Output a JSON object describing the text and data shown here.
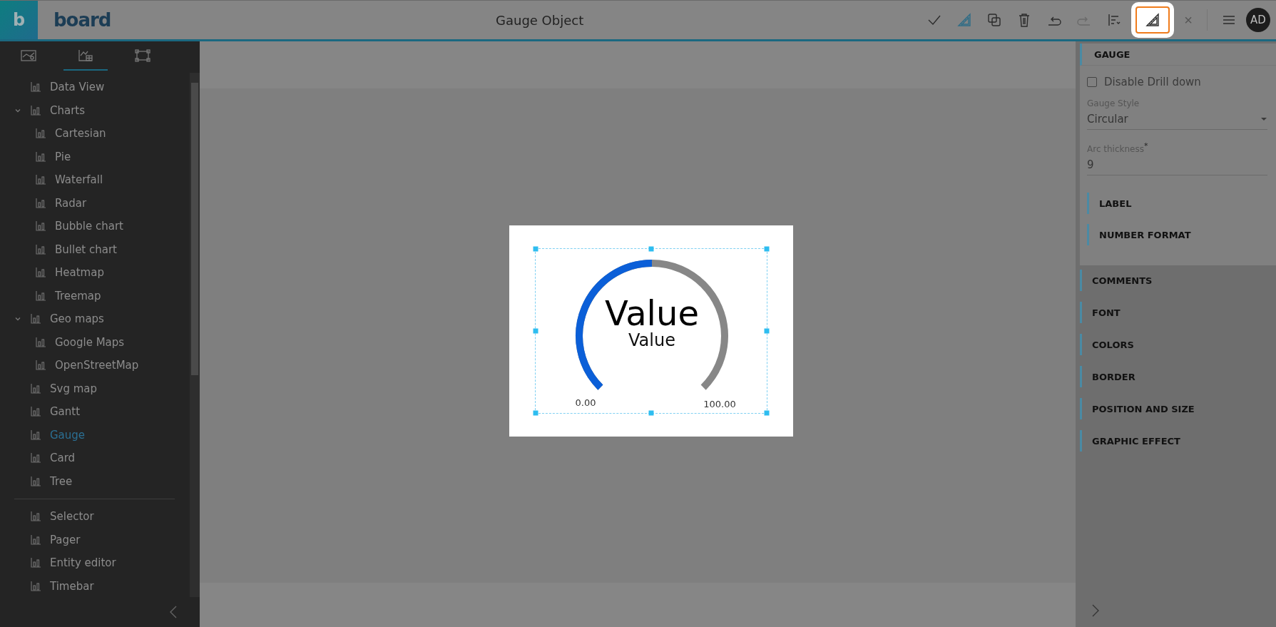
{
  "header": {
    "logo_letter": "b",
    "logo_text": "board",
    "title": "Gauge Object",
    "toolbar": [
      {
        "kind": "check",
        "active": false,
        "disabled": false,
        "highlighted": false
      },
      {
        "kind": "ruler",
        "active": true,
        "disabled": false,
        "highlighted": false
      },
      {
        "kind": "copy",
        "active": false,
        "disabled": false,
        "highlighted": false
      },
      {
        "kind": "trash",
        "active": false,
        "disabled": false,
        "highlighted": false
      },
      {
        "kind": "undo",
        "active": false,
        "disabled": false,
        "highlighted": false
      },
      {
        "kind": "redo",
        "active": false,
        "disabled": true,
        "highlighted": false
      },
      {
        "kind": "align",
        "active": false,
        "disabled": false,
        "highlighted": false
      },
      {
        "kind": "ruler",
        "active": false,
        "disabled": false,
        "highlighted": true
      }
    ],
    "close": "×",
    "avatar": "AD"
  },
  "sidebar": {
    "tabs": [
      {
        "kind": "layout",
        "selected": false
      },
      {
        "kind": "chart",
        "selected": true
      },
      {
        "kind": "frame",
        "selected": false
      }
    ],
    "groups": [
      {
        "items": [
          {
            "label": "Data View",
            "selected": false
          },
          {
            "label": "Charts",
            "selected": false,
            "expanded": true,
            "children": [
              {
                "label": "Cartesian",
                "selected": false
              },
              {
                "label": "Pie",
                "selected": false
              },
              {
                "label": "Waterfall",
                "selected": false
              },
              {
                "label": "Radar",
                "selected": false
              },
              {
                "label": "Bubble chart",
                "selected": false
              },
              {
                "label": "Bullet chart",
                "selected": false
              },
              {
                "label": "Heatmap",
                "selected": false
              },
              {
                "label": "Treemap",
                "selected": false
              }
            ]
          },
          {
            "label": "Geo maps",
            "selected": false,
            "expanded": true,
            "children": [
              {
                "label": "Google Maps",
                "selected": false
              },
              {
                "label": "OpenStreetMap",
                "selected": false
              }
            ]
          },
          {
            "label": "Svg map",
            "selected": false
          },
          {
            "label": "Gantt",
            "selected": false
          },
          {
            "label": "Gauge",
            "selected": true
          },
          {
            "label": "Card",
            "selected": false
          },
          {
            "label": "Tree",
            "selected": false
          }
        ]
      },
      {
        "items": [
          {
            "label": "Selector",
            "selected": false
          },
          {
            "label": "Pager",
            "selected": false
          },
          {
            "label": "Entity editor",
            "selected": false
          },
          {
            "label": "Timebar",
            "selected": false
          }
        ]
      }
    ]
  },
  "gauge": {
    "value_label": "Value",
    "caption": "Value",
    "min": "0.00",
    "max": "100.00",
    "level": 0.5
  },
  "properties": {
    "section": {
      "title": "GAUGE",
      "checkbox": {
        "label": "Disable Drill down",
        "checked": false
      },
      "style": {
        "label": "Gauge Style",
        "value": "Circular"
      },
      "thickness": {
        "label": "Arc thickness",
        "required_mark": "*",
        "value": "9"
      },
      "subsections": [
        "LABEL",
        "NUMBER FORMAT"
      ]
    },
    "sections": [
      "COMMENTS",
      "FONT",
      "COLORS",
      "BORDER",
      "POSITION AND SIZE",
      "GRAPHIC EFFECT"
    ]
  }
}
